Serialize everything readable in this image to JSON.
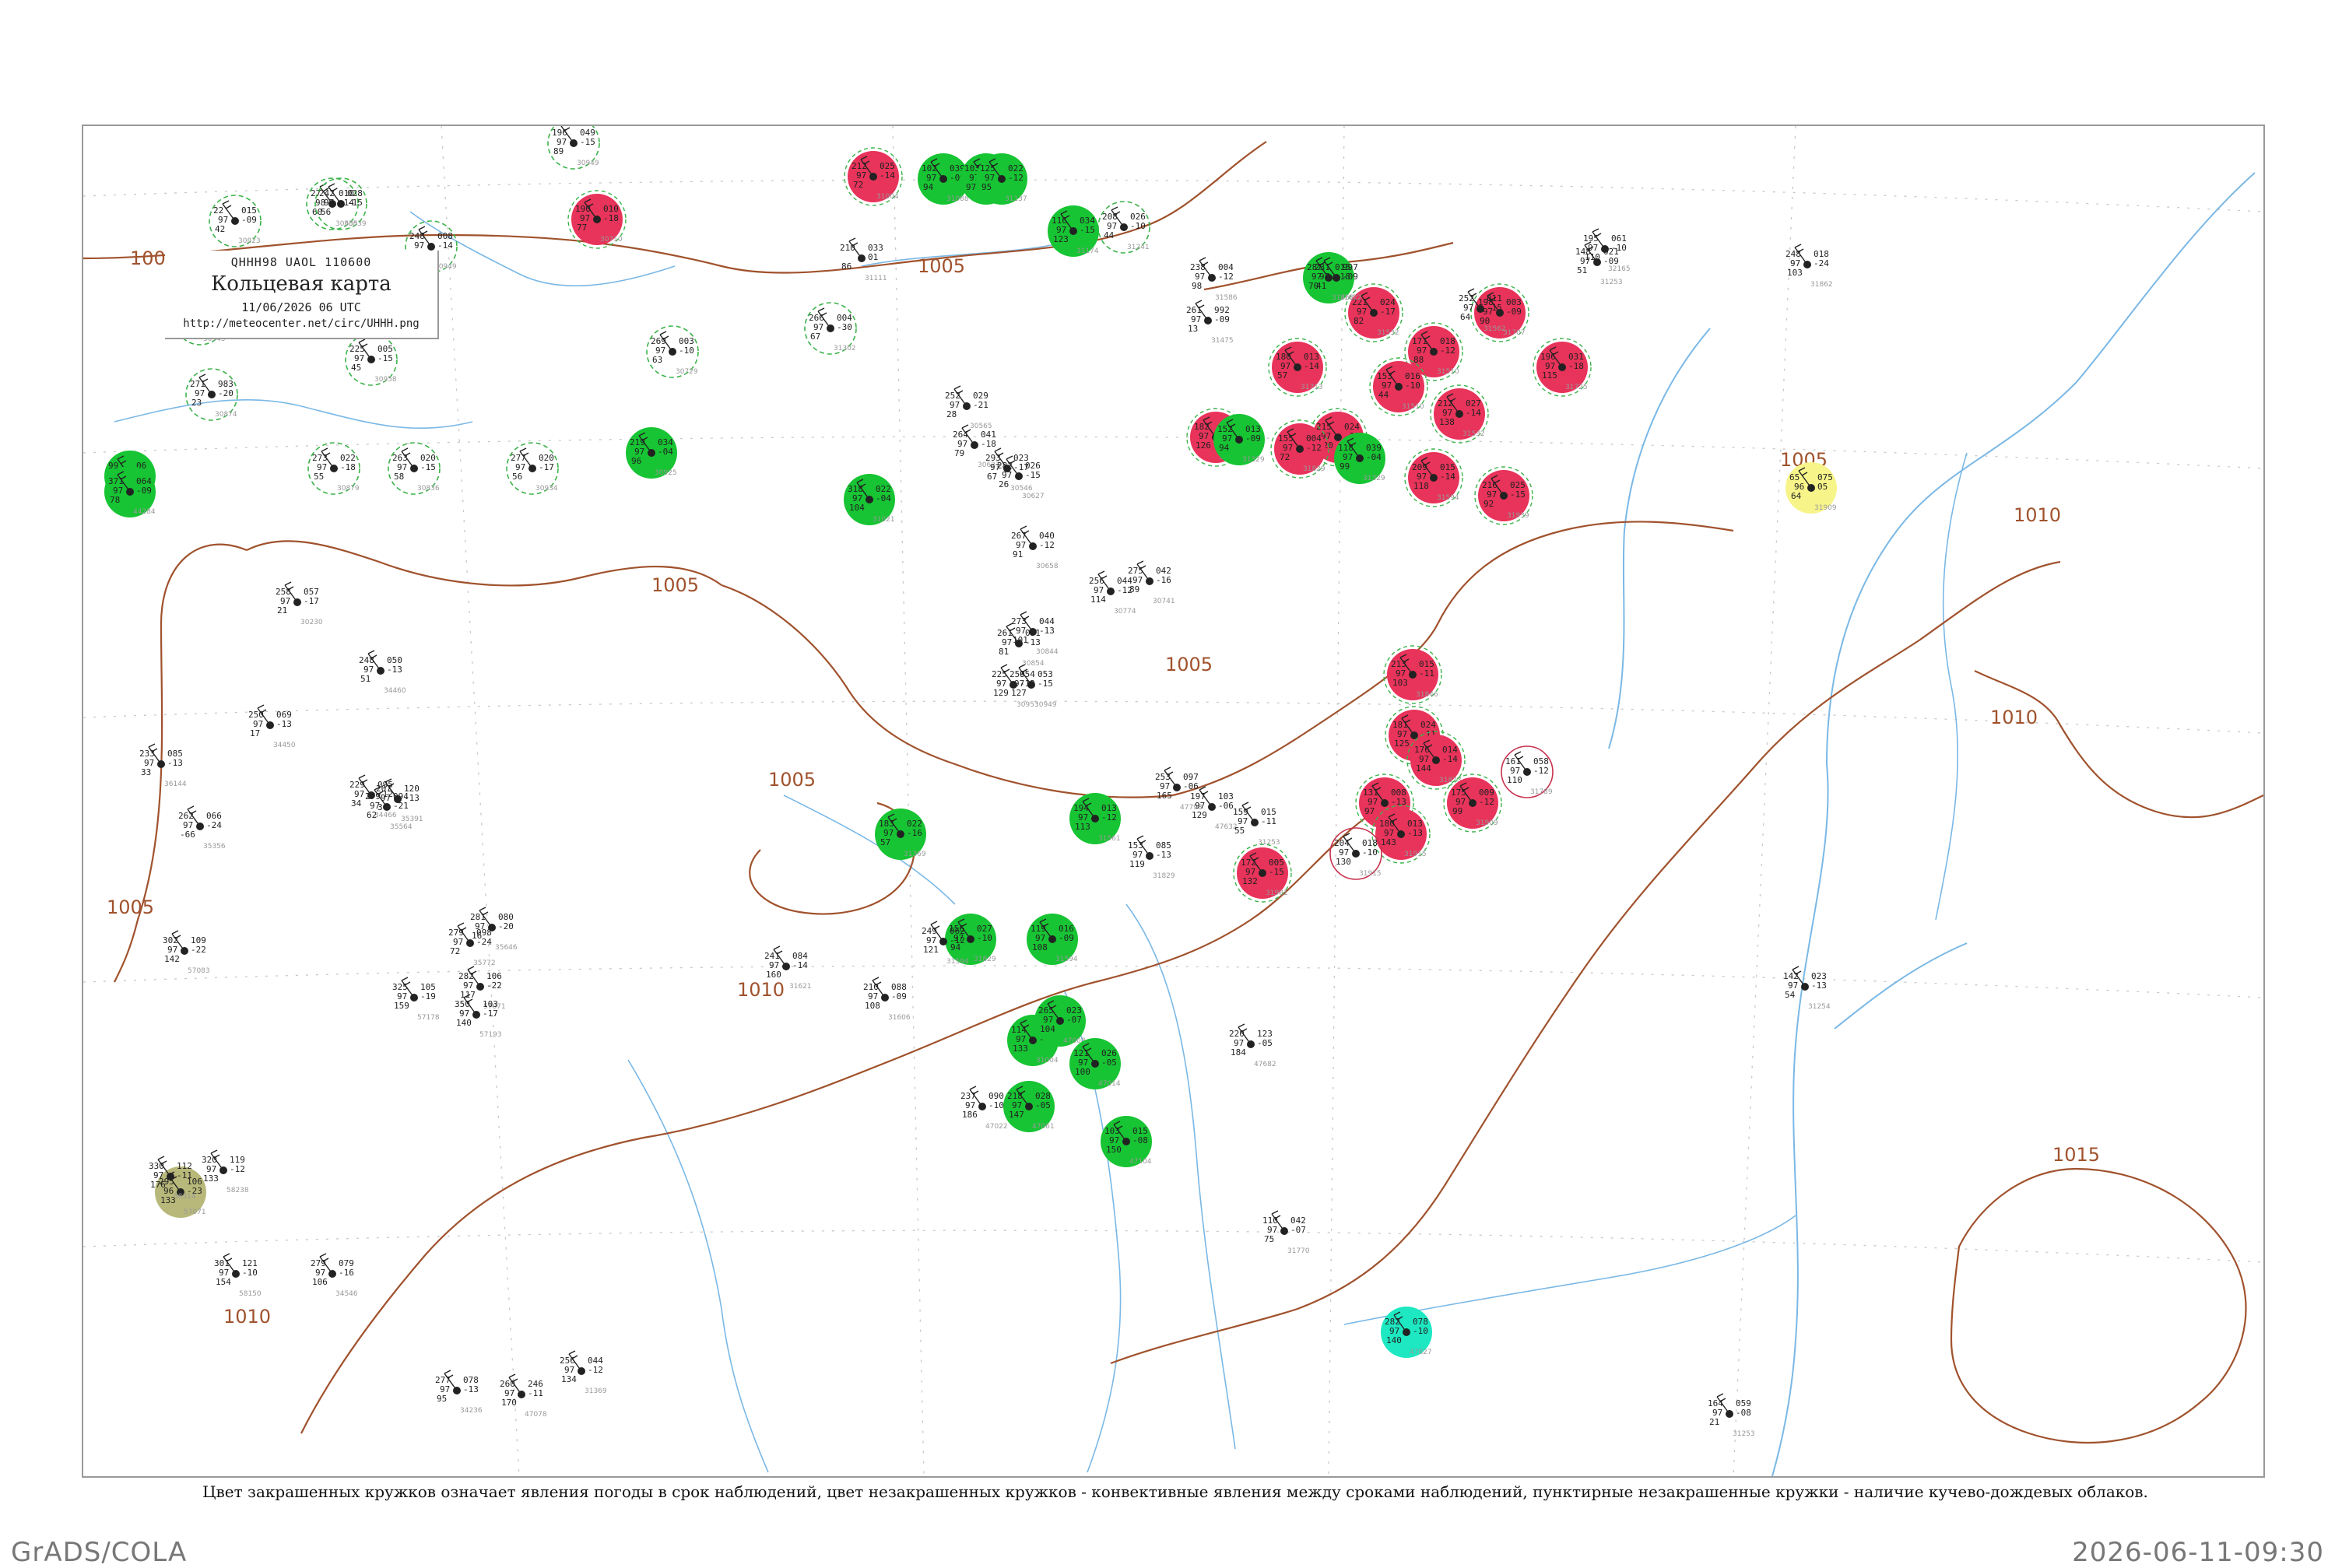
{
  "title_box": {
    "code": "QHHH98  UAOL  110600",
    "title": "Кольцевая карта",
    "date": "11/06/2026 06 UTC",
    "url": "http://meteocenter.net/circ/UHHH.png"
  },
  "caption": "Цвет закрашенных кружков означает явления погоды в срок наблюдений, цвет незакрашенных кружков - конвективные явления между сроками наблюдений, пунктирные незакрашенные кружки - наличие кучево-дождевых облаков.",
  "footer": {
    "left": "GrADS/COLA",
    "right": "2026-06-11-09:30"
  },
  "colors": {
    "isobar": "#a0522d",
    "water": "#7ab8e6",
    "thunder_fill": "#e8335a",
    "rain_fill": "#17c433",
    "fog_fill": "#1ee8c2",
    "haze_fill": "#f7f58a",
    "dust_fill": "#b8b87a",
    "cb_dashed": "#3cb34a",
    "convective_ring": "#c8324f"
  },
  "isobar_labels": [
    "1005",
    "1005",
    "1005",
    "1005",
    "1005",
    "1005",
    "1010",
    "1010",
    "1010",
    "1010",
    "1015",
    "1005"
  ],
  "stations": [
    {
      "kind": "rain-filled",
      "u": "99",
      "v": "98",
      "t": "171",
      "d": "06",
      "n": "10",
      "code": "50658"
    },
    {
      "kind": "cb-dashed",
      "u": "22",
      "v": "97",
      "t": "42",
      "d": "015",
      "n": "-09",
      "code": "30823"
    },
    {
      "kind": "cb-dashed",
      "u": "42",
      "v": "99",
      "t": "56",
      "d": "053",
      "n": "-08",
      "code": "30636"
    },
    {
      "kind": "cb-dashed",
      "u": "27",
      "v": "98",
      "t": "60",
      "d": "010",
      "n": "-14",
      "code": "30635"
    },
    {
      "kind": "cb-dashed",
      "u": "149",
      "v": "97",
      "t": "57",
      "d": "007",
      "n": "-08",
      "code": "30758"
    },
    {
      "kind": "cb-dashed",
      "u": "196",
      "v": "97",
      "t": "89",
      "d": "049",
      "n": "-15",
      "code": "30949"
    },
    {
      "kind": "thunder-filled",
      "u": "190",
      "v": "97",
      "t": "77",
      "d": "010",
      "n": "-18",
      "code": "30710"
    },
    {
      "kind": "thunder-filled",
      "u": "212",
      "v": "97",
      "t": "72",
      "d": "025",
      "n": "-14",
      "code": "31004"
    },
    {
      "kind": "rain-filled",
      "u": "102",
      "v": "97",
      "t": "94",
      "d": "039",
      "n": "-09",
      "code": "31088"
    },
    {
      "kind": "rain-filled",
      "u": "103",
      "v": "97",
      "t": "97",
      "d": "030",
      "n": "-11",
      "code": "31136"
    },
    {
      "kind": "rain-filled",
      "u": "125",
      "v": "97",
      "t": "95",
      "d": "022",
      "n": "-12",
      "code": "31137"
    },
    {
      "kind": "rain-filled",
      "u": "116",
      "v": "97",
      "t": "123",
      "d": "034",
      "n": "-15",
      "code": "31174"
    },
    {
      "kind": "cb-dashed",
      "u": "208",
      "v": "97",
      "t": "44",
      "d": "026",
      "n": "-10",
      "code": "31241"
    },
    {
      "kind": "cb-dashed",
      "u": "242",
      "v": "97",
      "t": "56",
      "d": "028",
      "n": "-15",
      "code": "30839"
    },
    {
      "kind": "cb-dashed",
      "u": "248",
      "v": "97",
      "t": "73",
      "d": "008",
      "n": "-14",
      "code": "30949"
    },
    {
      "kind": "cb-dashed",
      "u": "225",
      "v": "97",
      "t": "45",
      "d": "005",
      "n": "-15",
      "code": "30958"
    },
    {
      "kind": "cb-dashed",
      "u": "292",
      "v": "97",
      "t": "40",
      "d": "000",
      "n": "-13",
      "code": "30945"
    },
    {
      "kind": "cb-dashed",
      "u": "271",
      "v": "97",
      "t": "23",
      "d": "983",
      "n": "-20",
      "code": "30874"
    },
    {
      "kind": "cb-dashed",
      "u": "269",
      "v": "97",
      "t": "63",
      "d": "003",
      "n": "-10",
      "code": "30729"
    },
    {
      "kind": "cb-dashed",
      "u": "266",
      "v": "97",
      "t": "67",
      "d": "004",
      "n": "-30",
      "code": "31302"
    },
    {
      "kind": "rain-filled",
      "u": "371",
      "v": "97",
      "t": "78",
      "d": "064",
      "n": "-09",
      "code": "44284"
    },
    {
      "kind": "cb-dashed",
      "u": "273",
      "v": "97",
      "t": "55",
      "d": "022",
      "n": "-18",
      "code": "30879"
    },
    {
      "kind": "cb-dashed",
      "u": "263",
      "v": "97",
      "t": "58",
      "d": "020",
      "n": "-15",
      "code": "30836"
    },
    {
      "kind": "cb-dashed",
      "u": "277",
      "v": "97",
      "t": "56",
      "d": "020",
      "n": "-17",
      "code": "30934"
    },
    {
      "kind": "rain-filled",
      "u": "219",
      "v": "97",
      "t": "96",
      "d": "034",
      "n": "-04",
      "code": "30925"
    },
    {
      "kind": "rain-filled",
      "u": "318",
      "v": "97",
      "t": "104",
      "d": "022",
      "n": "-04",
      "code": "31021"
    },
    {
      "kind": "rain-filled",
      "u": "287",
      "v": "97",
      "t": "70",
      "d": "015",
      "n": "-18",
      "code": "31468"
    },
    {
      "kind": "thunder-filled",
      "u": "221",
      "v": "97",
      "t": "82",
      "d": "024",
      "n": "-17",
      "code": "31532"
    },
    {
      "kind": "thunder-filled",
      "u": "171",
      "v": "97",
      "t": "88",
      "d": "018",
      "n": "-12",
      "code": "31510"
    },
    {
      "kind": "thunder-filled",
      "u": "198",
      "v": "97",
      "t": "90",
      "d": "003",
      "n": "-09",
      "code": "31707"
    },
    {
      "kind": "thunder-filled",
      "u": "196",
      "v": "97",
      "t": "115",
      "d": "031",
      "n": "-18",
      "code": "31725"
    },
    {
      "kind": "thunder-filled",
      "u": "212",
      "v": "97",
      "t": "138",
      "d": "027",
      "n": "-14",
      "code": "31532"
    },
    {
      "kind": "thunder-filled",
      "u": "209",
      "v": "97",
      "t": "118",
      "d": "015",
      "n": "-14",
      "code": "31594"
    },
    {
      "kind": "thunder-filled",
      "u": "153",
      "v": "97",
      "t": "44",
      "d": "016",
      "n": "-10",
      "code": "31510"
    },
    {
      "kind": "thunder-filled",
      "u": "215",
      "v": "97",
      "t": "120",
      "d": "024",
      "n": "-11",
      "code": "31735"
    },
    {
      "kind": "thunder-filled",
      "u": "180",
      "v": "97",
      "t": "57",
      "d": "013",
      "n": "-14",
      "code": "31713"
    },
    {
      "kind": "thunder-filled",
      "u": "155",
      "v": "97",
      "t": "72",
      "d": "004",
      "n": "-12",
      "code": "31829"
    },
    {
      "kind": "thunder-filled",
      "u": "216",
      "v": "97",
      "t": "92",
      "d": "025",
      "n": "-15",
      "code": "31939"
    },
    {
      "kind": "thunder-filled",
      "u": "213",
      "v": "97",
      "t": "103",
      "d": "015",
      "n": "-11",
      "code": "31846"
    },
    {
      "kind": "thunder-filled",
      "u": "181",
      "v": "97",
      "t": "125",
      "d": "024",
      "n": "-11",
      "code": "31873"
    },
    {
      "kind": "thunder-filled",
      "u": "176",
      "v": "97",
      "t": "144",
      "d": "014",
      "n": "-14",
      "code": "31873"
    },
    {
      "kind": "thunder-filled",
      "u": "131",
      "v": "97",
      "t": "97",
      "d": "008",
      "n": "-13",
      "code": "31960"
    },
    {
      "kind": "thunder-filled",
      "u": "175",
      "v": "97",
      "t": "99",
      "d": "009",
      "n": "-12",
      "code": "31909"
    },
    {
      "kind": "thunder-filled",
      "u": "180",
      "v": "97",
      "t": "143",
      "d": "013",
      "n": "-13",
      "code": "31915"
    },
    {
      "kind": "thunder-filled",
      "u": "172",
      "v": "97",
      "t": "132",
      "d": "005",
      "n": "-15",
      "code": "31981"
    },
    {
      "kind": "thunder-filled",
      "u": "182",
      "v": "97",
      "t": "126",
      "d": "002",
      "n": "-13",
      "code": "31967"
    },
    {
      "kind": "rain-filled",
      "u": "152",
      "v": "97",
      "t": "94",
      "d": "013",
      "n": "-09",
      "code": "31329"
    },
    {
      "kind": "rain-filled",
      "u": "118",
      "v": "97",
      "t": "99",
      "d": "039",
      "n": "-04",
      "code": "31329"
    },
    {
      "kind": "rain-filled",
      "u": "194",
      "v": "97",
      "t": "113",
      "d": "013",
      "n": "-12",
      "code": "31561"
    },
    {
      "kind": "rain-filled",
      "u": "183",
      "v": "97",
      "t": "57",
      "d": "022",
      "n": "-16",
      "code": "31369"
    },
    {
      "kind": "rain-filled",
      "u": "156",
      "v": "97",
      "t": "94",
      "d": "027",
      "n": "-10",
      "code": "31829"
    },
    {
      "kind": "rain-filled",
      "u": "119",
      "v": "97",
      "t": "108",
      "d": "016",
      "n": "-09",
      "code": "31594"
    },
    {
      "kind": "rain-filled",
      "u": "114",
      "v": "97",
      "t": "133",
      "d": "030",
      "n": "-10",
      "code": "31004"
    },
    {
      "kind": "rain-filled",
      "u": "265",
      "v": "97",
      "t": "104",
      "d": "023",
      "n": "-07",
      "code": "47008"
    },
    {
      "kind": "rain-filled",
      "u": "121",
      "v": "97",
      "t": "100",
      "d": "026",
      "n": "-05",
      "code": "47014"
    },
    {
      "kind": "rain-filled",
      "u": "218",
      "v": "97",
      "t": "147",
      "d": "028",
      "n": "-05",
      "code": "47061"
    },
    {
      "kind": "rain-filled",
      "u": "103",
      "v": "97",
      "t": "150",
      "d": "015",
      "n": "-08",
      "code": "47104"
    },
    {
      "kind": "fog-filled",
      "u": "282",
      "v": "97",
      "t": "140",
      "d": "078",
      "n": "-10",
      "code": "47827"
    },
    {
      "kind": "haze-filled",
      "u": "65",
      "v": "96",
      "t": "64",
      "d": "075",
      "n": "05",
      "code": "31909"
    },
    {
      "kind": "dust-filled",
      "u": "295",
      "v": "96",
      "t": "133",
      "d": "106",
      "n": "-23",
      "code": "57071"
    },
    {
      "kind": "convective-ring",
      "u": "161",
      "v": "97",
      "t": "110",
      "d": "058",
      "n": "-12",
      "code": "31789"
    },
    {
      "kind": "convective-ring",
      "u": "204",
      "v": "97",
      "t": "130",
      "d": "018",
      "n": "-10",
      "code": "31915"
    },
    {
      "kind": "plain",
      "u": "210",
      "v": "",
      "t": "86",
      "d": "033",
      "n": "01",
      "code": "31111"
    },
    {
      "kind": "plain",
      "u": "238",
      "v": "97",
      "t": "98",
      "d": "004",
      "n": "-12",
      "code": "31586"
    },
    {
      "kind": "plain",
      "u": "231",
      "v": "97",
      "t": "41",
      "d": "997",
      "n": "-09",
      "code": "31622"
    },
    {
      "kind": "plain",
      "u": "252",
      "v": "97",
      "t": "64",
      "d": "011",
      "n": "-15",
      "code": "31562"
    },
    {
      "kind": "plain",
      "u": "261",
      "v": "97",
      "t": "13",
      "d": "992",
      "n": "-09",
      "code": "31475"
    },
    {
      "kind": "plain",
      "u": "252",
      "v": "97",
      "t": "28",
      "d": "029",
      "n": "-21",
      "code": "30565"
    },
    {
      "kind": "plain",
      "u": "264",
      "v": "97",
      "t": "79",
      "d": "041",
      "n": "-18",
      "code": "30627"
    },
    {
      "kind": "plain",
      "u": "293",
      "v": "97",
      "t": "67",
      "d": "023",
      "n": "-17",
      "code": "30546"
    },
    {
      "kind": "plain",
      "u": "282",
      "v": "97",
      "t": "26",
      "d": "026",
      "n": "-15",
      "code": "30627"
    },
    {
      "kind": "plain",
      "u": "267",
      "v": "97",
      "t": "91",
      "d": "040",
      "n": "-12",
      "code": "30658"
    },
    {
      "kind": "plain",
      "u": "275",
      "v": "97",
      "t": "89",
      "d": "042",
      "n": "-16",
      "code": "30741"
    },
    {
      "kind": "plain",
      "u": "256",
      "v": "97",
      "t": "114",
      "d": "044",
      "n": "-12",
      "code": "30774"
    },
    {
      "kind": "plain",
      "u": "273",
      "v": "97",
      "t": "101",
      "d": "044",
      "n": "-13",
      "code": "30844"
    },
    {
      "kind": "plain",
      "u": "261",
      "v": "97",
      "t": "81",
      "d": "051",
      "n": "-13",
      "code": "30854"
    },
    {
      "kind": "plain",
      "u": "259",
      "v": "97",
      "t": "127",
      "d": "053",
      "n": "-15",
      "code": "30949"
    },
    {
      "kind": "plain",
      "u": "225",
      "v": "97",
      "t": "129",
      "d": "054",
      "n": "-12",
      "code": "30953"
    },
    {
      "kind": "plain",
      "u": "258",
      "v": "97",
      "t": "21",
      "d": "057",
      "n": "-17",
      "code": "30230"
    },
    {
      "kind": "plain",
      "u": "250",
      "v": "97",
      "t": "17",
      "d": "069",
      "n": "-13",
      "code": "34450"
    },
    {
      "kind": "plain",
      "u": "233",
      "v": "97",
      "t": "33",
      "d": "085",
      "n": "-13",
      "code": "36144"
    },
    {
      "kind": "plain",
      "u": "262",
      "v": "97",
      "t": "-66",
      "d": "066",
      "n": "-24",
      "code": "35356"
    },
    {
      "kind": "plain",
      "u": "248",
      "v": "97",
      "t": "51",
      "d": "050",
      "n": "-13",
      "code": "34460"
    },
    {
      "kind": "plain",
      "u": "229",
      "v": "97",
      "t": "34",
      "d": "095",
      "n": "-12",
      "code": "34466"
    },
    {
      "kind": "plain",
      "u": "207",
      "v": "97",
      "t": "34",
      "d": "120",
      "n": "-13",
      "code": "35391"
    },
    {
      "kind": "plain",
      "u": "279",
      "v": "97",
      "t": "62",
      "d": "094",
      "n": "-21",
      "code": "35564"
    },
    {
      "kind": "plain",
      "u": "281",
      "v": "97",
      "t": "16",
      "d": "080",
      "n": "-20",
      "code": "35646"
    },
    {
      "kind": "plain",
      "u": "279",
      "v": "97",
      "t": "72",
      "d": "098",
      "n": "-24",
      "code": "35772"
    },
    {
      "kind": "plain",
      "u": "282",
      "v": "97",
      "t": "117",
      "d": "106",
      "n": "-22",
      "code": "57071"
    },
    {
      "kind": "plain",
      "u": "302",
      "v": "97",
      "t": "142",
      "d": "109",
      "n": "-22",
      "code": "57083"
    },
    {
      "kind": "plain",
      "u": "325",
      "v": "97",
      "t": "159",
      "d": "105",
      "n": "-19",
      "code": "57178"
    },
    {
      "kind": "plain",
      "u": "350",
      "v": "97",
      "t": "140",
      "d": "103",
      "n": "-17",
      "code": "57193"
    },
    {
      "kind": "plain",
      "u": "330",
      "v": "97",
      "t": "176",
      "d": "112",
      "n": "-11",
      "code": "58314"
    },
    {
      "kind": "plain",
      "u": "320",
      "v": "97",
      "t": "133",
      "d": "119",
      "n": "-12",
      "code": "58238"
    },
    {
      "kind": "plain",
      "u": "301",
      "v": "97",
      "t": "154",
      "d": "121",
      "n": "-10",
      "code": "58150"
    },
    {
      "kind": "plain",
      "u": "279",
      "v": "97",
      "t": "106",
      "d": "079",
      "n": "-16",
      "code": "34546"
    },
    {
      "kind": "plain",
      "u": "277",
      "v": "97",
      "t": "95",
      "d": "078",
      "n": "-13",
      "code": "34236"
    },
    {
      "kind": "plain",
      "u": "260",
      "v": "97",
      "t": "170",
      "d": "246",
      "n": "-11",
      "code": "47078"
    },
    {
      "kind": "plain",
      "u": "256",
      "v": "97",
      "t": "134",
      "d": "044",
      "n": "-12",
      "code": "31369"
    },
    {
      "kind": "plain",
      "u": "249",
      "v": "97",
      "t": "121",
      "d": "062",
      "n": "-12",
      "code": "31594"
    },
    {
      "kind": "plain",
      "u": "241",
      "v": "97",
      "t": "160",
      "d": "084",
      "n": "-14",
      "code": "31621"
    },
    {
      "kind": "plain",
      "u": "210",
      "v": "97",
      "t": "108",
      "d": "088",
      "n": "-09",
      "code": "31606"
    },
    {
      "kind": "plain",
      "u": "237",
      "v": "97",
      "t": "186",
      "d": "090",
      "n": "-10",
      "code": "47022"
    },
    {
      "kind": "plain",
      "u": "253",
      "v": "97",
      "t": "165",
      "d": "097",
      "n": "-06",
      "code": "47798"
    },
    {
      "kind": "plain",
      "u": "197",
      "v": "97",
      "t": "129",
      "d": "103",
      "n": "-06",
      "code": "47632"
    },
    {
      "kind": "plain",
      "u": "159",
      "v": "97",
      "t": "55",
      "d": "015",
      "n": "-11",
      "code": "31253"
    },
    {
      "kind": "plain",
      "u": "153",
      "v": "97",
      "t": "119",
      "d": "085",
      "n": "-13",
      "code": "31829"
    },
    {
      "kind": "plain",
      "u": "220",
      "v": "97",
      "t": "184",
      "d": "123",
      "n": "-05",
      "code": "47682"
    },
    {
      "kind": "plain",
      "u": "110",
      "v": "97",
      "t": "75",
      "d": "042",
      "n": "-07",
      "code": "31770"
    },
    {
      "kind": "plain",
      "u": "142",
      "v": "97",
      "t": "54",
      "d": "023",
      "n": "-13",
      "code": "31254"
    },
    {
      "kind": "plain",
      "u": "148",
      "v": "97",
      "t": "51",
      "d": "021",
      "n": "-09",
      "code": "31253"
    },
    {
      "kind": "plain",
      "u": "164",
      "v": "97",
      "t": "21",
      "d": "059",
      "n": "-08",
      "code": "31253"
    },
    {
      "kind": "plain",
      "u": "195",
      "v": "97",
      "t": "110",
      "d": "061",
      "n": "-10",
      "code": "32165"
    },
    {
      "kind": "plain",
      "u": "248",
      "v": "97",
      "t": "103",
      "d": "018",
      "n": "-24",
      "code": "31862"
    }
  ]
}
